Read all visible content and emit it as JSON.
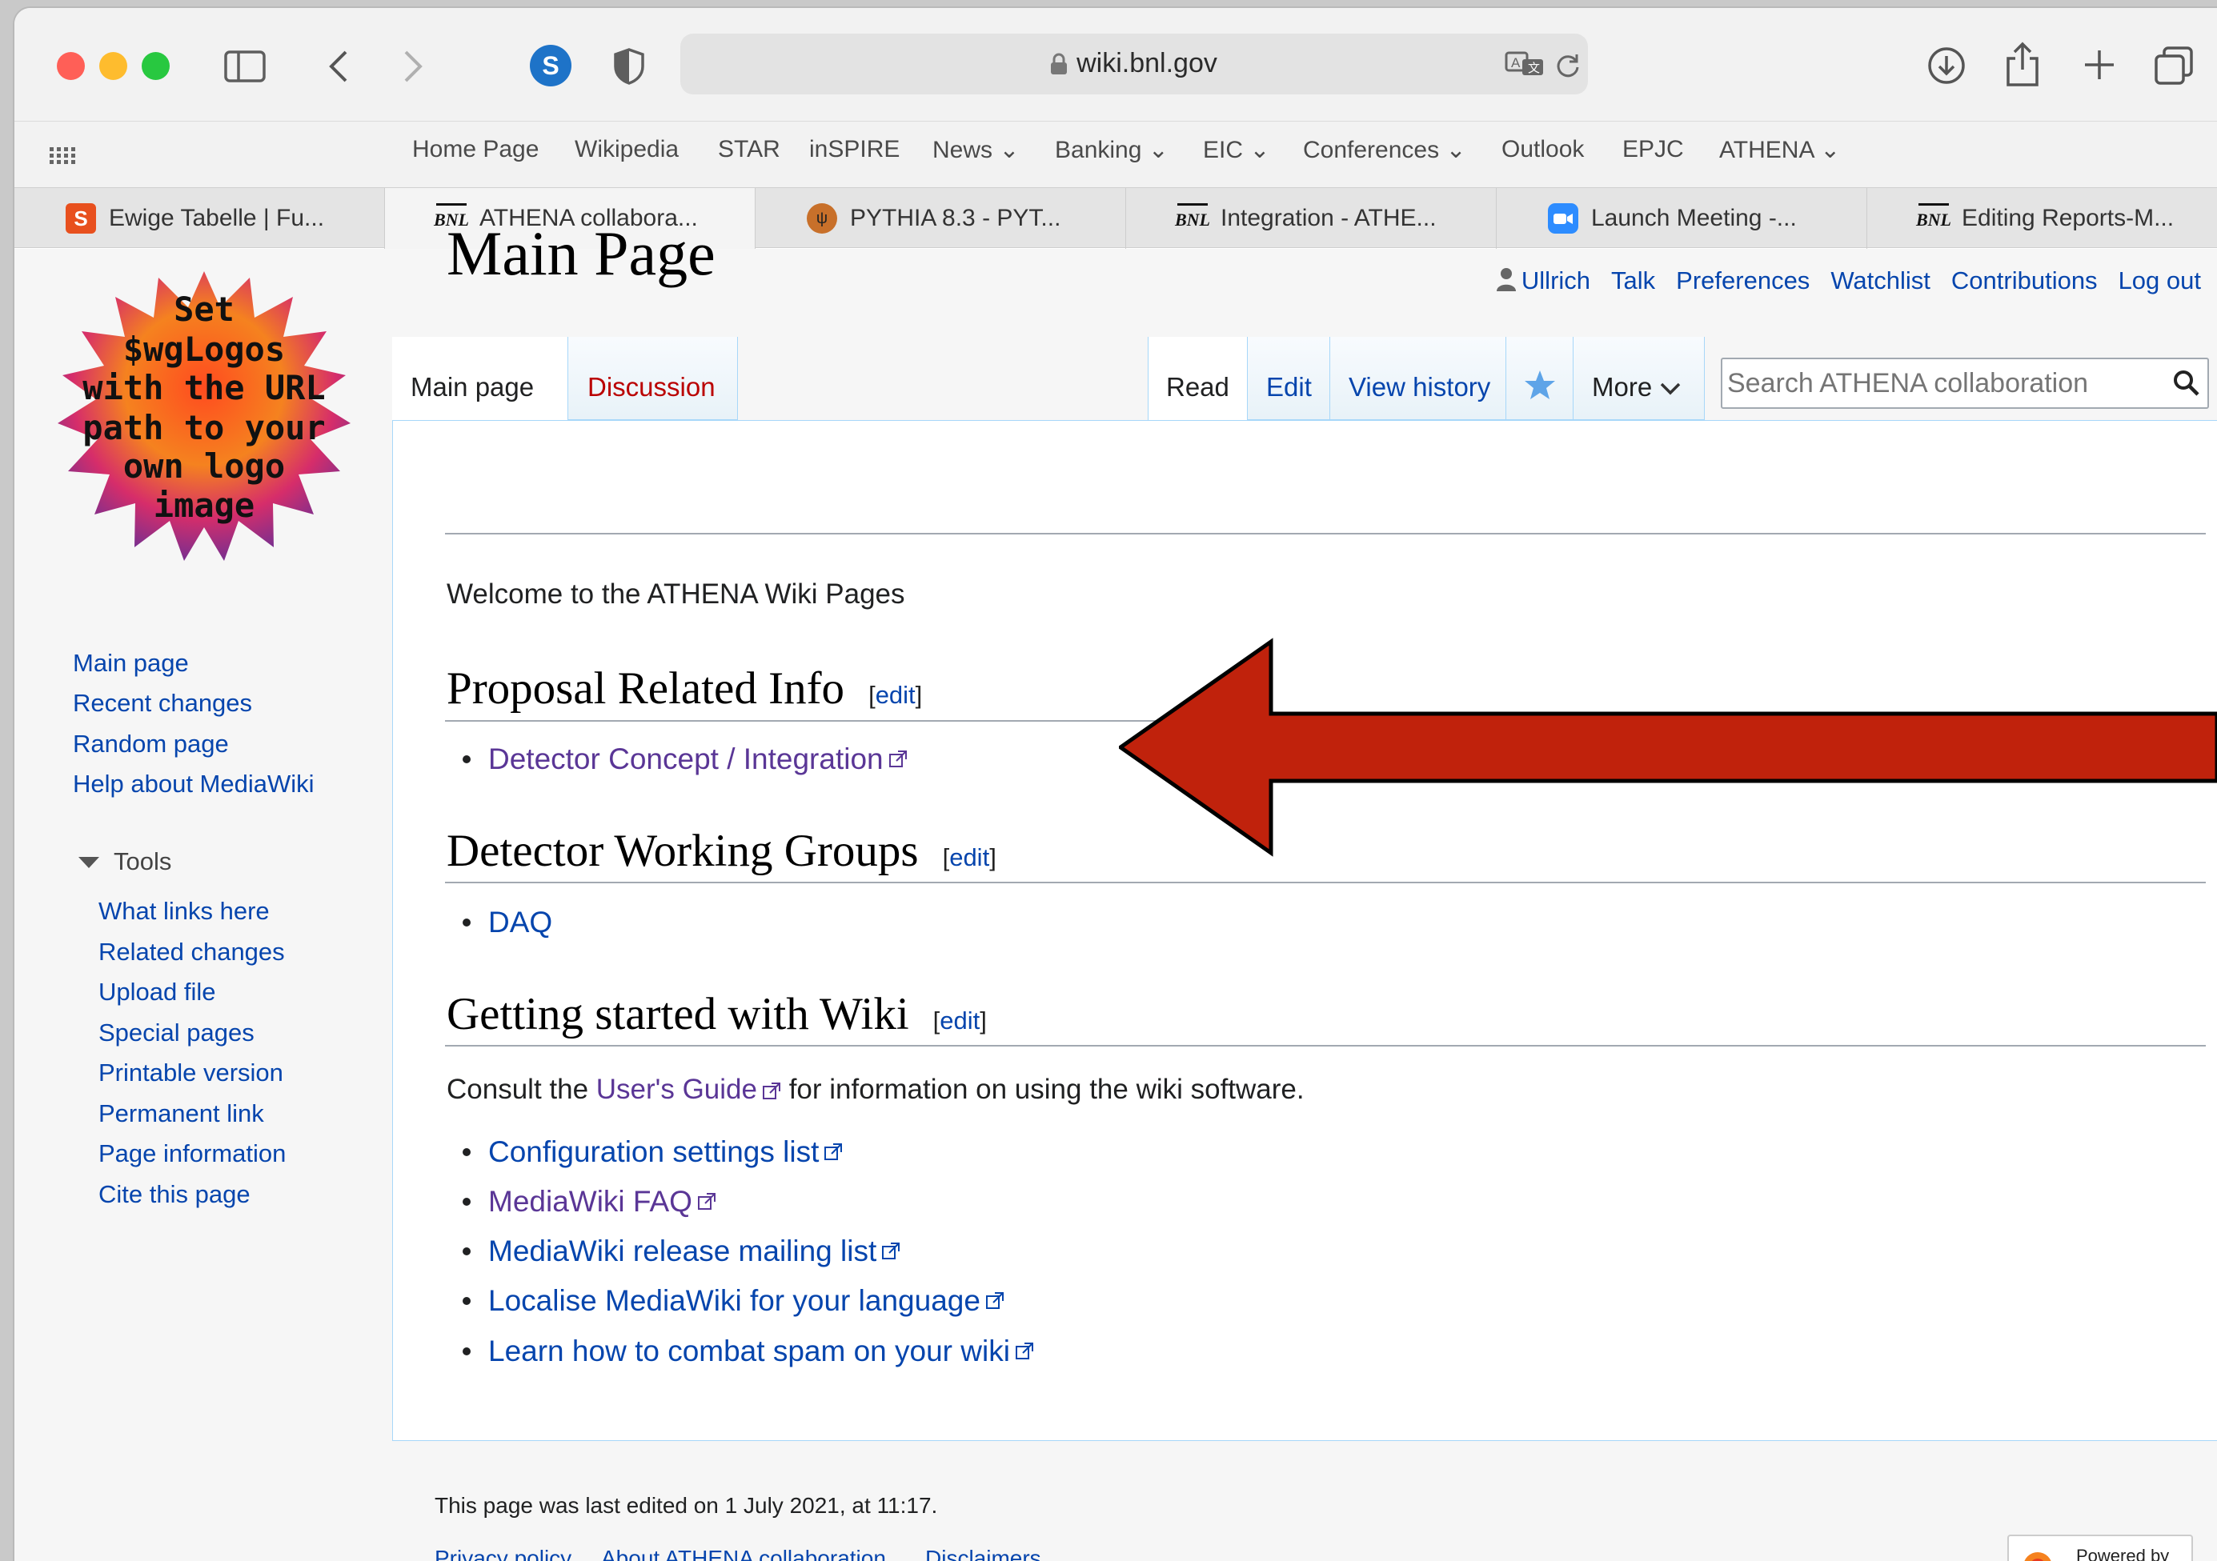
{
  "browser": {
    "url": "wiki.bnl.gov",
    "favorites": [
      "Home Page",
      "Wikipedia",
      "STAR",
      "inSPIRE",
      "News",
      "Banking",
      "EIC",
      "Conferences",
      "Outlook",
      "EPJC",
      "ATHENA"
    ],
    "tabs": [
      {
        "label": "Ewige Tabelle | Fu...",
        "icon": "s-icon"
      },
      {
        "label": "ATHENA collabora...",
        "icon": "bnl-icon"
      },
      {
        "label": "PYTHIA 8.3 - PYT...",
        "icon": "pythia-icon"
      },
      {
        "label": "Integration - ATHE...",
        "icon": "bnl-icon"
      },
      {
        "label": "Launch Meeting -...",
        "icon": "zoom-icon"
      },
      {
        "label": "Editing Reports-M...",
        "icon": "bnl-icon"
      }
    ]
  },
  "personal": {
    "user": "Ullrich",
    "talk": "Talk",
    "preferences": "Preferences",
    "watchlist": "Watchlist",
    "contributions": "Contributions",
    "logout": "Log out"
  },
  "logo_text": [
    "Set",
    "$wgLogos",
    "with the URL",
    "path to your",
    "own logo",
    "image"
  ],
  "nav": {
    "items": [
      "Main page",
      "Recent changes",
      "Random page",
      "Help about MediaWiki"
    ],
    "tools_heading": "Tools",
    "tools": [
      "What links here",
      "Related changes",
      "Upload file",
      "Special pages",
      "Printable version",
      "Permanent link",
      "Page information",
      "Cite this page"
    ]
  },
  "page_tabs": {
    "main": "Main page",
    "discussion": "Discussion",
    "read": "Read",
    "edit": "Edit",
    "history": "View history",
    "more": "More",
    "search_placeholder": "Search ATHENA collaboration"
  },
  "content": {
    "title": "Main Page",
    "welcome": "Welcome to the ATHENA Wiki Pages",
    "sections": [
      {
        "heading": "Proposal Related Info",
        "edit": "edit"
      },
      {
        "heading": "Detector Working Groups",
        "edit": "edit"
      },
      {
        "heading": "Getting started with Wiki",
        "edit": "edit"
      }
    ],
    "proposal_link": "Detector Concept / Integration",
    "daq_link": "DAQ",
    "consult_pre": "Consult the ",
    "consult_link": "User's Guide",
    "consult_post": " for information on using the wiki software.",
    "links": [
      "Configuration settings list",
      "MediaWiki FAQ",
      "MediaWiki release mailing list",
      "Localise MediaWiki for your language",
      "Learn how to combat spam on your wiki"
    ]
  },
  "footer": {
    "last_edited": "This page was last edited on 1 July 2021, at 11:17.",
    "links": [
      "Privacy policy",
      "About ATHENA collaboration",
      "Disclaimers"
    ],
    "powered": "Powered by"
  },
  "colors": {
    "arrow": "#c0220c",
    "link": "#0645ad",
    "visited": "#5a3696",
    "redlink": "#ba0000"
  }
}
